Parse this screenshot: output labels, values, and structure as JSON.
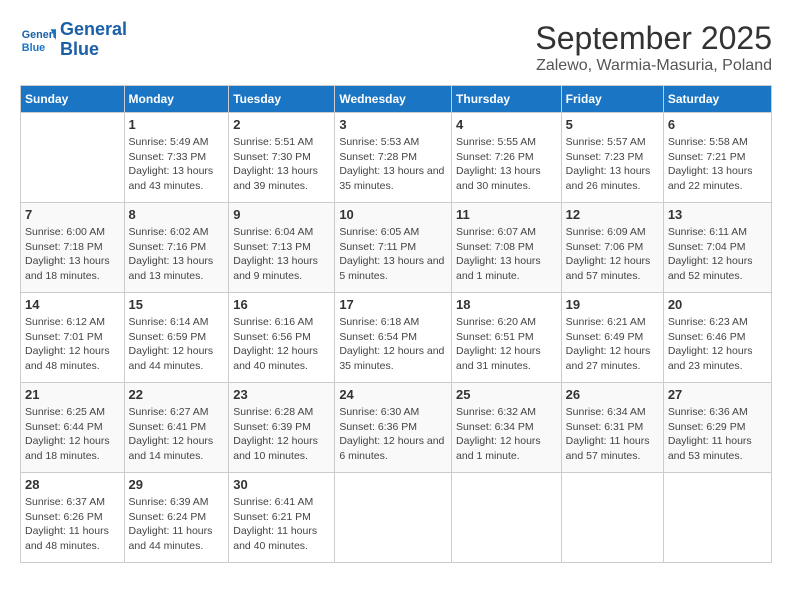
{
  "logo": {
    "line1": "General",
    "line2": "Blue"
  },
  "title": "September 2025",
  "subtitle": "Zalewo, Warmia-Masuria, Poland",
  "days_of_week": [
    "Sunday",
    "Monday",
    "Tuesday",
    "Wednesday",
    "Thursday",
    "Friday",
    "Saturday"
  ],
  "weeks": [
    [
      {
        "day": "",
        "sunrise": "",
        "sunset": "",
        "daylight": ""
      },
      {
        "day": "1",
        "sunrise": "Sunrise: 5:49 AM",
        "sunset": "Sunset: 7:33 PM",
        "daylight": "Daylight: 13 hours and 43 minutes."
      },
      {
        "day": "2",
        "sunrise": "Sunrise: 5:51 AM",
        "sunset": "Sunset: 7:30 PM",
        "daylight": "Daylight: 13 hours and 39 minutes."
      },
      {
        "day": "3",
        "sunrise": "Sunrise: 5:53 AM",
        "sunset": "Sunset: 7:28 PM",
        "daylight": "Daylight: 13 hours and 35 minutes."
      },
      {
        "day": "4",
        "sunrise": "Sunrise: 5:55 AM",
        "sunset": "Sunset: 7:26 PM",
        "daylight": "Daylight: 13 hours and 30 minutes."
      },
      {
        "day": "5",
        "sunrise": "Sunrise: 5:57 AM",
        "sunset": "Sunset: 7:23 PM",
        "daylight": "Daylight: 13 hours and 26 minutes."
      },
      {
        "day": "6",
        "sunrise": "Sunrise: 5:58 AM",
        "sunset": "Sunset: 7:21 PM",
        "daylight": "Daylight: 13 hours and 22 minutes."
      }
    ],
    [
      {
        "day": "7",
        "sunrise": "Sunrise: 6:00 AM",
        "sunset": "Sunset: 7:18 PM",
        "daylight": "Daylight: 13 hours and 18 minutes."
      },
      {
        "day": "8",
        "sunrise": "Sunrise: 6:02 AM",
        "sunset": "Sunset: 7:16 PM",
        "daylight": "Daylight: 13 hours and 13 minutes."
      },
      {
        "day": "9",
        "sunrise": "Sunrise: 6:04 AM",
        "sunset": "Sunset: 7:13 PM",
        "daylight": "Daylight: 13 hours and 9 minutes."
      },
      {
        "day": "10",
        "sunrise": "Sunrise: 6:05 AM",
        "sunset": "Sunset: 7:11 PM",
        "daylight": "Daylight: 13 hours and 5 minutes."
      },
      {
        "day": "11",
        "sunrise": "Sunrise: 6:07 AM",
        "sunset": "Sunset: 7:08 PM",
        "daylight": "Daylight: 13 hours and 1 minute."
      },
      {
        "day": "12",
        "sunrise": "Sunrise: 6:09 AM",
        "sunset": "Sunset: 7:06 PM",
        "daylight": "Daylight: 12 hours and 57 minutes."
      },
      {
        "day": "13",
        "sunrise": "Sunrise: 6:11 AM",
        "sunset": "Sunset: 7:04 PM",
        "daylight": "Daylight: 12 hours and 52 minutes."
      }
    ],
    [
      {
        "day": "14",
        "sunrise": "Sunrise: 6:12 AM",
        "sunset": "Sunset: 7:01 PM",
        "daylight": "Daylight: 12 hours and 48 minutes."
      },
      {
        "day": "15",
        "sunrise": "Sunrise: 6:14 AM",
        "sunset": "Sunset: 6:59 PM",
        "daylight": "Daylight: 12 hours and 44 minutes."
      },
      {
        "day": "16",
        "sunrise": "Sunrise: 6:16 AM",
        "sunset": "Sunset: 6:56 PM",
        "daylight": "Daylight: 12 hours and 40 minutes."
      },
      {
        "day": "17",
        "sunrise": "Sunrise: 6:18 AM",
        "sunset": "Sunset: 6:54 PM",
        "daylight": "Daylight: 12 hours and 35 minutes."
      },
      {
        "day": "18",
        "sunrise": "Sunrise: 6:20 AM",
        "sunset": "Sunset: 6:51 PM",
        "daylight": "Daylight: 12 hours and 31 minutes."
      },
      {
        "day": "19",
        "sunrise": "Sunrise: 6:21 AM",
        "sunset": "Sunset: 6:49 PM",
        "daylight": "Daylight: 12 hours and 27 minutes."
      },
      {
        "day": "20",
        "sunrise": "Sunrise: 6:23 AM",
        "sunset": "Sunset: 6:46 PM",
        "daylight": "Daylight: 12 hours and 23 minutes."
      }
    ],
    [
      {
        "day": "21",
        "sunrise": "Sunrise: 6:25 AM",
        "sunset": "Sunset: 6:44 PM",
        "daylight": "Daylight: 12 hours and 18 minutes."
      },
      {
        "day": "22",
        "sunrise": "Sunrise: 6:27 AM",
        "sunset": "Sunset: 6:41 PM",
        "daylight": "Daylight: 12 hours and 14 minutes."
      },
      {
        "day": "23",
        "sunrise": "Sunrise: 6:28 AM",
        "sunset": "Sunset: 6:39 PM",
        "daylight": "Daylight: 12 hours and 10 minutes."
      },
      {
        "day": "24",
        "sunrise": "Sunrise: 6:30 AM",
        "sunset": "Sunset: 6:36 PM",
        "daylight": "Daylight: 12 hours and 6 minutes."
      },
      {
        "day": "25",
        "sunrise": "Sunrise: 6:32 AM",
        "sunset": "Sunset: 6:34 PM",
        "daylight": "Daylight: 12 hours and 1 minute."
      },
      {
        "day": "26",
        "sunrise": "Sunrise: 6:34 AM",
        "sunset": "Sunset: 6:31 PM",
        "daylight": "Daylight: 11 hours and 57 minutes."
      },
      {
        "day": "27",
        "sunrise": "Sunrise: 6:36 AM",
        "sunset": "Sunset: 6:29 PM",
        "daylight": "Daylight: 11 hours and 53 minutes."
      }
    ],
    [
      {
        "day": "28",
        "sunrise": "Sunrise: 6:37 AM",
        "sunset": "Sunset: 6:26 PM",
        "daylight": "Daylight: 11 hours and 48 minutes."
      },
      {
        "day": "29",
        "sunrise": "Sunrise: 6:39 AM",
        "sunset": "Sunset: 6:24 PM",
        "daylight": "Daylight: 11 hours and 44 minutes."
      },
      {
        "day": "30",
        "sunrise": "Sunrise: 6:41 AM",
        "sunset": "Sunset: 6:21 PM",
        "daylight": "Daylight: 11 hours and 40 minutes."
      },
      {
        "day": "",
        "sunrise": "",
        "sunset": "",
        "daylight": ""
      },
      {
        "day": "",
        "sunrise": "",
        "sunset": "",
        "daylight": ""
      },
      {
        "day": "",
        "sunrise": "",
        "sunset": "",
        "daylight": ""
      },
      {
        "day": "",
        "sunrise": "",
        "sunset": "",
        "daylight": ""
      }
    ]
  ]
}
